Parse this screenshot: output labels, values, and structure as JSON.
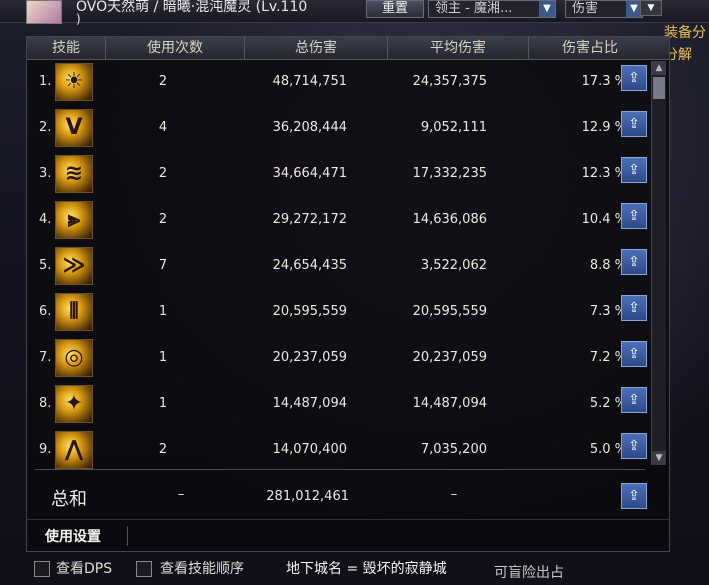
{
  "character": {
    "name": "OVO天然萌 / 暗曦·混沌魔灵 (Lv.110",
    "name_cont": ")"
  },
  "toolbar": {
    "reset_label": "重置",
    "boss_filter": "领主 - 魔湘...",
    "damage_filter": "伤害"
  },
  "side_label": {
    "line1": "装备分",
    "line2": "分解"
  },
  "table": {
    "headers": [
      "技能",
      "使用次数",
      "总伤害",
      "平均伤害",
      "伤害占比"
    ],
    "rows": [
      {
        "rank": "1.",
        "uses": "2",
        "total": "48,714,751",
        "avg": "24,357,375",
        "pct": "17.3 %"
      },
      {
        "rank": "2.",
        "uses": "4",
        "total": "36,208,444",
        "avg": "9,052,111",
        "pct": "12.9 %"
      },
      {
        "rank": "3.",
        "uses": "2",
        "total": "34,664,471",
        "avg": "17,332,235",
        "pct": "12.3 %"
      },
      {
        "rank": "4.",
        "uses": "2",
        "total": "29,272,172",
        "avg": "14,636,086",
        "pct": "10.4 %"
      },
      {
        "rank": "5.",
        "uses": "7",
        "total": "24,654,435",
        "avg": "3,522,062",
        "pct": "8.8 %"
      },
      {
        "rank": "6.",
        "uses": "1",
        "total": "20,595,559",
        "avg": "20,595,559",
        "pct": "7.3 %"
      },
      {
        "rank": "7.",
        "uses": "1",
        "total": "20,237,059",
        "avg": "20,237,059",
        "pct": "7.2 %"
      },
      {
        "rank": "8.",
        "uses": "1",
        "total": "14,487,094",
        "avg": "14,487,094",
        "pct": "5.2 %"
      },
      {
        "rank": "9.",
        "uses": "2",
        "total": "14,070,400",
        "avg": "7,035,200",
        "pct": "5.0 %"
      }
    ]
  },
  "totals": {
    "label": "总和",
    "uses": "–",
    "total": "281,012,461",
    "avg": "–"
  },
  "settings_tab": "使用设置",
  "bottom": {
    "view_dps": "查看DPS",
    "view_order": "查看技能顺序",
    "dungeon": "地下城名 = 毁坏的寂静城",
    "right_text": "可盲险出占"
  },
  "icons": {
    "share": "share-export-icon",
    "scroll_up": "arrow-up-icon",
    "scroll_down": "arrow-down-icon",
    "dropdown": "chevron-down-icon",
    "skill": "skill-icon"
  }
}
